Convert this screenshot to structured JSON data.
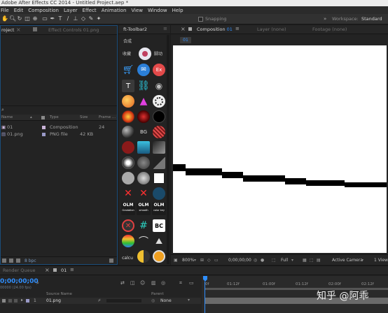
{
  "window": {
    "title": "Adobe After Effects CC 2014 - Untitled Project.aep *"
  },
  "menu": [
    "File",
    "Edit",
    "Composition",
    "Layer",
    "Effect",
    "Animation",
    "View",
    "Window",
    "Help"
  ],
  "toolbar": {
    "snapping_label": "Snapping",
    "workspace_label": "Workspace:",
    "workspace_value": "Standard"
  },
  "project_panel": {
    "tab_project": "roject",
    "tab_effect_controls": "Effect Controls 01.png",
    "search_icon": "search-icon",
    "columns": [
      "Name",
      "Type",
      "Size",
      "Frame ..."
    ],
    "items": [
      {
        "name": "01",
        "type": "Composition",
        "size": "",
        "frame": "24",
        "color": "#c9b3d8"
      },
      {
        "name": "01.png",
        "type": "PNG file",
        "size": "42 KB",
        "frame": "",
        "color": "#9a9ac8"
      }
    ],
    "bpc": "8 bpc"
  },
  "toolbar2_panel": {
    "tab": "ft-Toolbar2",
    "category": "合成",
    "fav_label": "收藏",
    "run_label": "脚动",
    "bg_label": "BG",
    "olm": [
      {
        "title": "OLM",
        "sub": "Gradation"
      },
      {
        "title": "OLM",
        "sub": "smooth"
      },
      {
        "title": "OLM",
        "sub": "color key"
      }
    ],
    "calc_label": "calcu",
    "bc_label": "BC"
  },
  "composition_panel": {
    "tab_comp_prefix": "Composition",
    "tab_comp_name": "01",
    "tab_layer": "Layer (none)",
    "tab_footage": "Footage (none)",
    "comp_button": "01",
    "zoom": "800%",
    "timecode": "0;00;00;00",
    "resolution": "Full",
    "camera": "Active Camera",
    "views": "1 View"
  },
  "timeline": {
    "tab_render": "Render Queue",
    "tab_comp": "01",
    "timecode": "0;00;00;00",
    "fps": "00000 (24.00 fps)",
    "columns": [
      "Source Name",
      "Parent"
    ],
    "layer": {
      "index": "1",
      "name": "01.png",
      "parent": "None"
    },
    "ruler": [
      "0f",
      "01:12f",
      "01:00f",
      "01:12f",
      "02:00f",
      "02:12f"
    ]
  },
  "watermark": "知乎 @阿乖"
}
